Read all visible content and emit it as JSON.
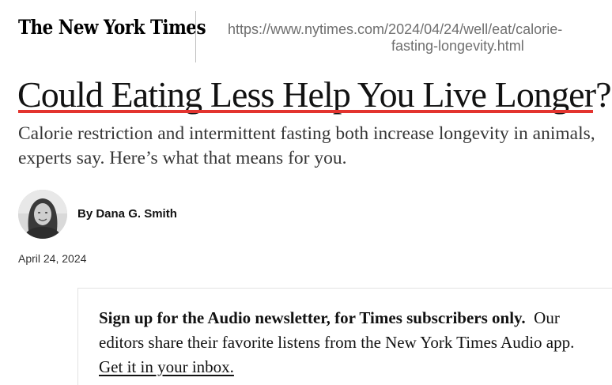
{
  "header": {
    "logo": "The New York Times",
    "url_line1": "https://www.nytimes.com/2024/04/24/well/eat/calorie-",
    "url_line2": "fasting-longevity.html"
  },
  "article": {
    "headline": "Could Eating Less Help You Live Longer?",
    "summary_line1": "Calorie restriction and intermittent fasting both increase longevity in animals,",
    "summary_line2": "experts say. Here’s what that means for you.",
    "byline": "By Dana G. Smith",
    "date": "April 24, 2024"
  },
  "newsletter": {
    "title": "Sign up for the Audio newsletter, for Times subscribers only.",
    "body_line1": "Our",
    "body_line2": "editors share their favorite listens from the New York Times Audio app.",
    "link": "Get it in your inbox."
  },
  "colors": {
    "headline_underline": "#e3342f",
    "text": "#121212",
    "url_gray": "#6f6f6f"
  }
}
